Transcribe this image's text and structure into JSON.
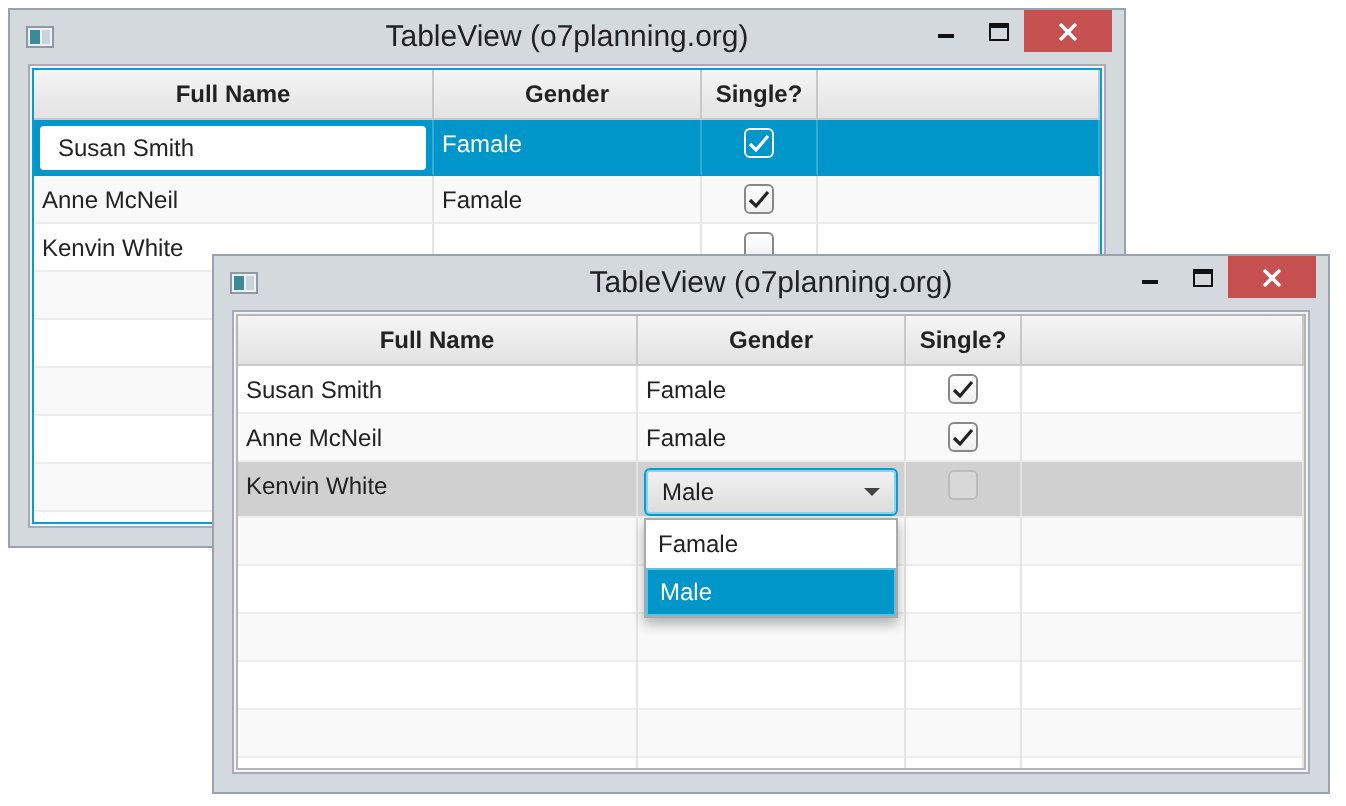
{
  "windows": [
    {
      "title": "TableView (o7planning.org)",
      "table_focused": true,
      "columns": [
        "Full Name",
        "Gender",
        "Single?"
      ],
      "rows": [
        {
          "full_name": "Susan Smith",
          "gender": "Famale",
          "single": true,
          "selected": true,
          "kind": "textfield"
        },
        {
          "full_name": "Anne McNeil",
          "gender": "Famale",
          "single": true,
          "selected": false
        },
        {
          "full_name": "Kenvin White",
          "single": false,
          "selected": false
        }
      ]
    },
    {
      "title": "TableView (o7planning.org)",
      "table_focused": false,
      "columns": [
        "Full Name",
        "Gender",
        "Single?"
      ],
      "rows": [
        {
          "full_name": "Susan Smith",
          "gender": "Famale",
          "single": true,
          "selected": false
        },
        {
          "full_name": "Anne McNeil",
          "gender": "Famale",
          "single": true,
          "selected": false
        },
        {
          "full_name": "Kenvin White",
          "gender": "Male",
          "single": false,
          "selected": true,
          "kind": "combobox"
        }
      ],
      "dropdown": {
        "options": [
          {
            "label": "Famale",
            "selected": false
          },
          {
            "label": "Male",
            "selected": true
          }
        ]
      }
    }
  ]
}
